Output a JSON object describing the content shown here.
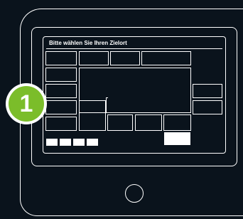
{
  "screen": {
    "title": "Bitte wählen Sie Ihren Zielort"
  },
  "step_badge": {
    "number": "1",
    "color": "#7bbd2a"
  },
  "colors": {
    "background": "#0a131c",
    "outline": "#ffffff",
    "badge": "#7bbd2a"
  }
}
